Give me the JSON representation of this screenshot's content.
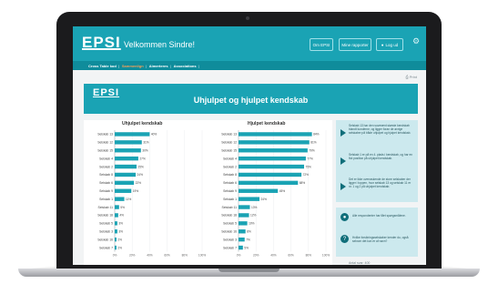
{
  "header": {
    "logo": "EPSI",
    "welcome": "Velkommen Sindre!",
    "buttons": [
      "Om EPSI",
      "Mine rapporter",
      "Log ud"
    ]
  },
  "nav": {
    "items": [
      "Cross Table kod",
      "Sammenlign",
      "Aimerteres",
      "Associations"
    ],
    "active_index": 1
  },
  "print_label": "Print",
  "banner": {
    "logo": "EPSI",
    "title": "Uhjulpet og hjulpet kendskab"
  },
  "side": {
    "points": [
      "Selskab 13 har den suverænt største kendskab blandt kunderne, og ligger foran de øvrige selskaber på både uhjulpet og hjulpet kendskab.",
      "Selskab 1 er på en 4. plads i kendskab, og har en flot position på uhjulpet kendskab.",
      "Det er ikke overraskende de store selskaber der ligger i toppen, hvor selskab 13 og selskab 11 er nr. 1 og 2 på uhjulpet kendskab."
    ],
    "info": [
      "Alle respondenter har fået spørgsmålene.",
      "Hvilke forsikringsselskaber kender du, også selvom det kun er af navn?"
    ],
    "footer": "Antal svar: 400"
  },
  "colors": {
    "accent": "#1aa3b4",
    "nav": "#0f8c9b",
    "bar": "#1aa3b4",
    "active_nav": "#f0a05a",
    "panel": "#cce9ee"
  },
  "chart_data": [
    {
      "type": "bar",
      "orientation": "horizontal",
      "title": "Uhjulpet kendskab",
      "categories": [
        "Selskab 13",
        "Selskab 12",
        "Selskab 15",
        "Selskab 4",
        "Selskab 2",
        "Selskab 8",
        "Selskab 6",
        "Selskab 9",
        "Selskab 1",
        "Selskab 11",
        "Selskab 18",
        "Selskab 5",
        "Selskab 3",
        "Selskab 16",
        "Selskab 7"
      ],
      "values": [
        40,
        31,
        30,
        27,
        25,
        24,
        22,
        19,
        11,
        5,
        4,
        3,
        3,
        2,
        2
      ],
      "value_labels": [
        "40%",
        "31%",
        "30%",
        "27%",
        "25%",
        "24%",
        "22%",
        "19%",
        "11%",
        "5%",
        "4%",
        "3%",
        "3%",
        "2%",
        "2%"
      ],
      "xlim": [
        0,
        100
      ],
      "xticks": [
        "0%",
        "20%",
        "40%",
        "60%",
        "80%",
        "100%"
      ]
    },
    {
      "type": "bar",
      "orientation": "horizontal",
      "title": "Hjulpet kendskab",
      "categories": [
        "Selskab 13",
        "Selskab 12",
        "Selskab 15",
        "Selskab 4",
        "Selskab 2",
        "Selskab 8",
        "Selskab 6",
        "Selskab 9",
        "Selskab 1",
        "Selskab 11",
        "Selskab 18",
        "Selskab 5",
        "Selskab 16",
        "Selskab 3",
        "Selskab 7"
      ],
      "values": [
        84,
        81,
        79,
        77,
        75,
        72,
        68,
        45,
        24,
        13,
        12,
        10,
        8,
        7,
        5
      ],
      "value_labels": [
        "84%",
        "81%",
        "79%",
        "77%",
        "75%",
        "72%",
        "68%",
        "45%",
        "24%",
        "13%",
        "12%",
        "10%",
        "8%",
        "7%",
        "5%"
      ],
      "xlim": [
        0,
        100
      ],
      "xticks": [
        "0%",
        "20%",
        "40%",
        "60%",
        "80%",
        "100%"
      ]
    }
  ]
}
